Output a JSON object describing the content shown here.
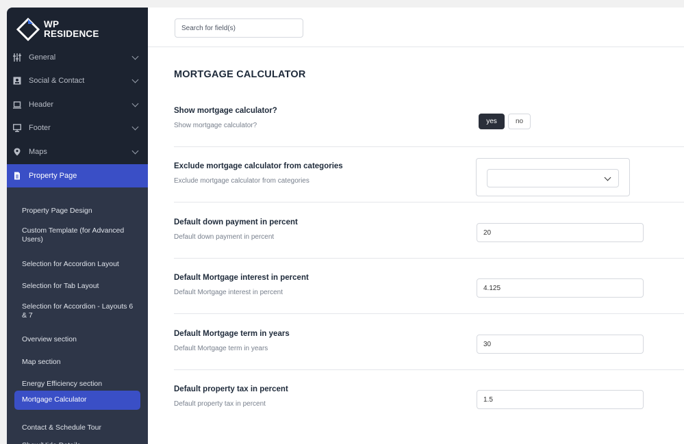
{
  "brand": {
    "line1": "WP",
    "line2": "RESIDENCE"
  },
  "search": {
    "placeholder": "Search for field(s)"
  },
  "sidebar": {
    "items": [
      {
        "label": "General",
        "icon": "sliders-icon"
      },
      {
        "label": "Social & Contact",
        "icon": "contact-card-icon"
      },
      {
        "label": "Header",
        "icon": "laptop-icon"
      },
      {
        "label": "Footer",
        "icon": "monitor-icon"
      },
      {
        "label": "Maps",
        "icon": "map-pin-icon"
      },
      {
        "label": "Property Page",
        "icon": "document-icon"
      }
    ],
    "subitems": [
      {
        "label": "Property Page Design"
      },
      {
        "label": "Custom Template (for Advanced Users)"
      },
      {
        "label": "Selection for Accordion Layout"
      },
      {
        "label": "Selection for Tab Layout"
      },
      {
        "label": "Selection for Accordion - Layouts 6 & 7"
      },
      {
        "label": "Overview section"
      },
      {
        "label": "Map section"
      },
      {
        "label": "Energy Efficiency section"
      },
      {
        "label": "Mortgage Calculator"
      },
      {
        "label": "Contact & Schedule Tour"
      },
      {
        "label": "Show/Hide Details"
      }
    ]
  },
  "main": {
    "title": "MORTGAGE CALCULATOR",
    "show_calc": {
      "title": "Show mortgage calculator?",
      "desc": "Show mortgage calculator?",
      "yes": "yes",
      "no": "no"
    },
    "exclude": {
      "title": "Exclude mortgage calculator from categories",
      "desc": "Exclude mortgage calculator from categories",
      "value": ""
    },
    "down_payment": {
      "title": "Default down payment in percent",
      "desc": "Default down payment in percent",
      "value": "20"
    },
    "interest": {
      "title": "Default Mortgage interest in percent",
      "desc": "Default Mortgage interest in percent",
      "value": "4.125"
    },
    "term": {
      "title": "Default Mortgage term in years",
      "desc": "Default Mortgage term in years",
      "value": "30"
    },
    "tax": {
      "title": "Default property tax in percent",
      "desc": "Default property tax in percent",
      "value": "1.5"
    }
  },
  "colors": {
    "sidebar_bg": "#1c2330",
    "submenu_bg": "#2e3648",
    "accent": "#3a4fc6",
    "toggle_active": "#2a2f3a"
  }
}
